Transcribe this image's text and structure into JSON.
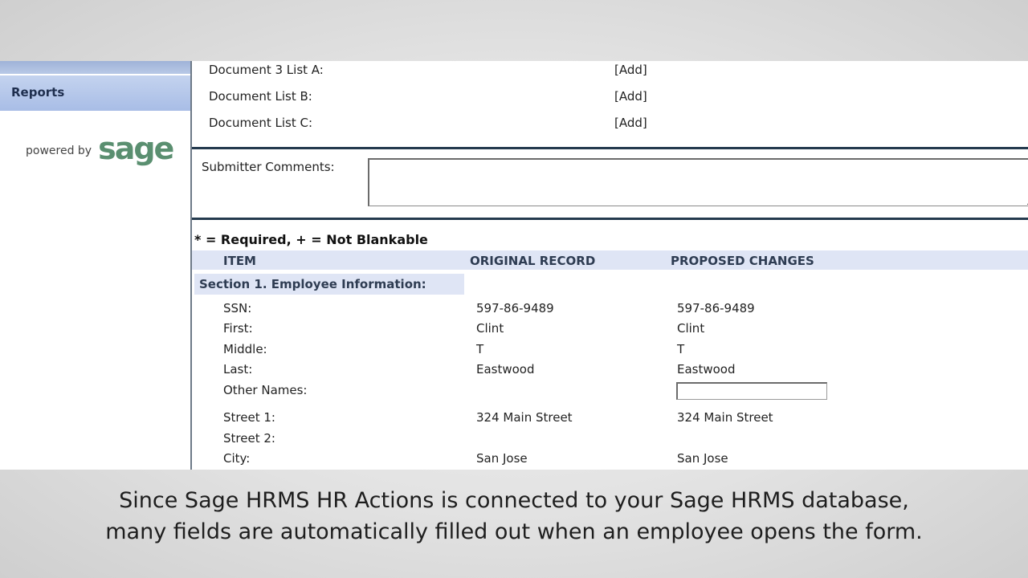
{
  "sidebar": {
    "nav_item": "Reports",
    "powered_by": "powered by",
    "logo_text": "sage"
  },
  "documents": [
    {
      "label": "Document 3 List A:",
      "action": "[Add]"
    },
    {
      "label": "Document List B:",
      "action": "[Add]"
    },
    {
      "label": "Document List C:",
      "action": "[Add]"
    }
  ],
  "comments": {
    "label": "Submitter Comments:",
    "value": ""
  },
  "legend": "* = Required, + = Not Blankable",
  "columns": {
    "item": "ITEM",
    "original": "ORIGINAL RECORD",
    "proposed": "PROPOSED CHANGES"
  },
  "section": "Section 1. Employee Information:",
  "fields": [
    {
      "label": "SSN:",
      "original": "597-86-9489",
      "proposed": "597-86-9489"
    },
    {
      "label": "First:",
      "original": "Clint",
      "proposed": "Clint"
    },
    {
      "label": "Middle:",
      "original": "T",
      "proposed": "T"
    },
    {
      "label": "Last:",
      "original": "Eastwood",
      "proposed": "Eastwood"
    },
    {
      "label": "Other Names:",
      "original": "",
      "proposed": ""
    },
    {
      "label": "Street 1:",
      "original": "324 Main Street",
      "proposed": "324 Main Street"
    },
    {
      "label": "Street 2:",
      "original": "",
      "proposed": ""
    },
    {
      "label": "City:",
      "original": "San Jose",
      "proposed": "San Jose"
    }
  ],
  "caption": {
    "line1": "Since Sage HRMS HR Actions is connected to your Sage HRMS database,",
    "line2": "many fields are automatically filled out when an employee opens the form."
  },
  "colors": {
    "brand": "#5a8f70",
    "nav": "#b8c8e6",
    "header_band": "#dfe5f5",
    "divider": "#243a4e"
  }
}
